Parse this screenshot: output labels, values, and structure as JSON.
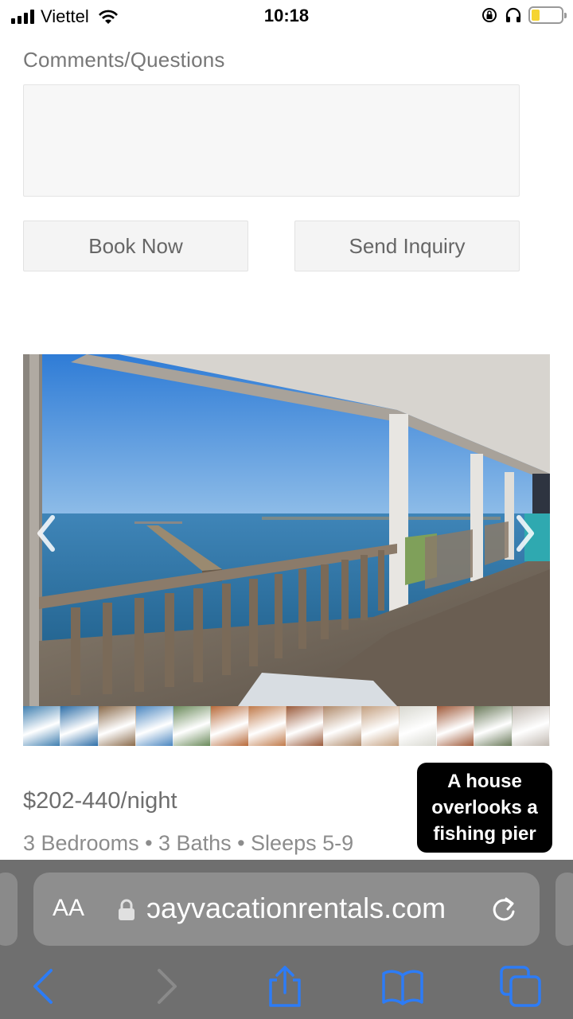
{
  "status_bar": {
    "carrier": "Viettel",
    "time": "10:18"
  },
  "form": {
    "comments_label": "Comments/Questions",
    "comments_value": "",
    "book_now_label": "Book Now",
    "send_inquiry_label": "Send Inquiry"
  },
  "listing": {
    "price": "$202-440/night",
    "specs": "3 Bedrooms • 3 Baths • Sleeps 5-9",
    "caption_line1": "A house",
    "caption_line2": "overlooks a",
    "caption_line3": "fishing pier",
    "gallery_icons": [
      "chevron-left-icon",
      "chevron-right-icon"
    ],
    "thumbnail_colors": [
      "#3f7fb0",
      "#2f6fa8",
      "#8a6a4a",
      "#4a86c0",
      "#6a8a5a",
      "#b86a3a",
      "#c07a4a",
      "#9a5a3a",
      "#b08a6a",
      "#c4a080",
      "#d8d8d0",
      "#a05a3a",
      "#6a7a5a",
      "#c0b8b0"
    ]
  },
  "browser": {
    "aa_label": "AA",
    "url": "ɔayvacationrentals.com",
    "icons": [
      "back-icon",
      "forward-icon",
      "share-icon",
      "bookmarks-icon",
      "tabs-icon",
      "lock-icon",
      "reload-icon"
    ]
  },
  "colors": {
    "browser_bar": "#6f6f6f",
    "toolbar_icon": "#2d7cf6",
    "battery": "#f5d431"
  }
}
